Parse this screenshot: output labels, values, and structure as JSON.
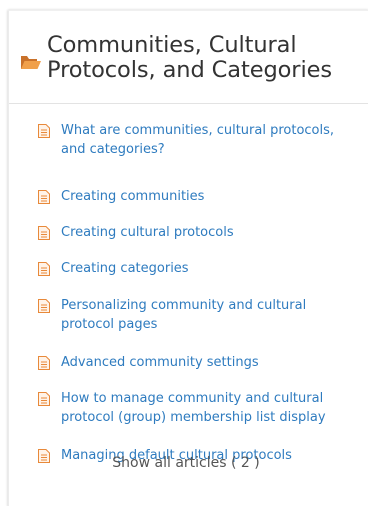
{
  "section": {
    "title": "Communities, Cultural Protocols, and Categories",
    "icon": "folder-open-icon",
    "icon_color": "#e8893a"
  },
  "articles": [
    {
      "label": "What are communities, cultural protocols, and categories?",
      "icon": "document-icon"
    },
    {
      "label": "Creating communities",
      "icon": "document-icon"
    },
    {
      "label": "Creating cultural protocols",
      "icon": "document-icon"
    },
    {
      "label": "Creating categories",
      "icon": "document-icon"
    },
    {
      "label": "Personalizing community and cultural protocol pages",
      "icon": "document-icon"
    },
    {
      "label": "Advanced community settings",
      "icon": "document-icon"
    },
    {
      "label": "How to manage community and cultural protocol (group) membership list display",
      "icon": "document-icon"
    },
    {
      "label": "Managing default cultural protocols",
      "icon": "document-icon"
    }
  ],
  "show_all": {
    "label": "Show all articles ( 2 )"
  },
  "colors": {
    "link": "#2e7bbf",
    "title": "#333333",
    "doc_icon": "#e8893a"
  }
}
